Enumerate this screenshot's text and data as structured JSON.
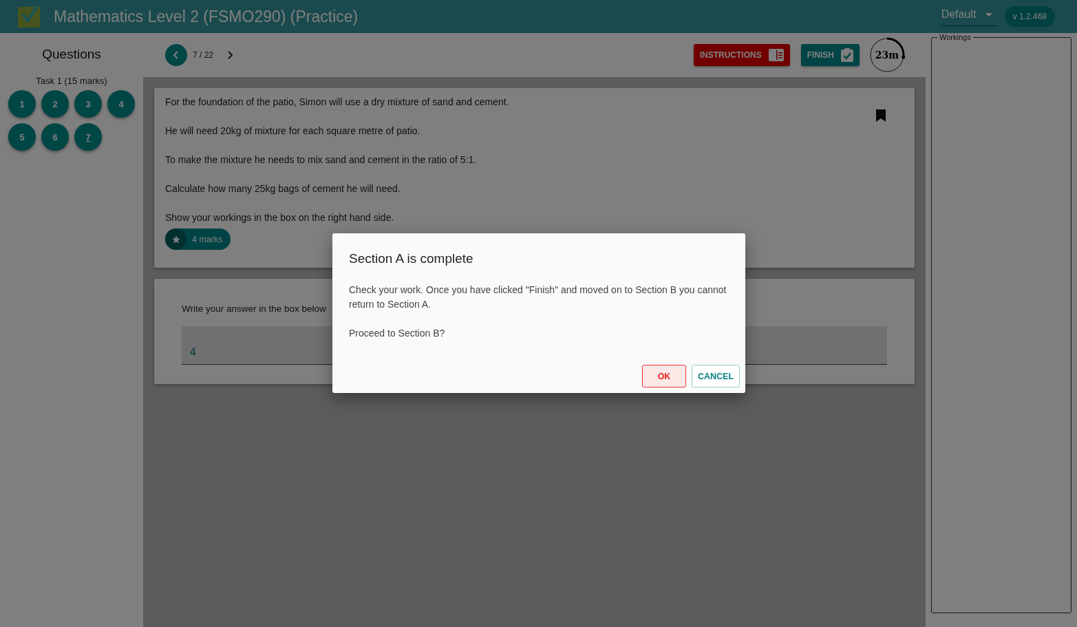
{
  "header": {
    "title": "Mathematics Level 2 (FSMO290) (Practice)",
    "theme_select": {
      "value": "Default"
    },
    "version": "v 1.2.468"
  },
  "sidebar": {
    "title": "Questions",
    "task": "Task 1 (15 marks)",
    "questions": [
      {
        "label": "1",
        "selected": false
      },
      {
        "label": "2",
        "selected": false
      },
      {
        "label": "3",
        "selected": false
      },
      {
        "label": "4",
        "selected": false
      },
      {
        "label": "5",
        "selected": false
      },
      {
        "label": "6",
        "selected": false
      },
      {
        "label": "7",
        "selected": true
      }
    ]
  },
  "toolbar": {
    "position": "7 / 22",
    "instructions": "INSTRUCTIONS",
    "finish": "FINISH",
    "timer": {
      "label": "23m",
      "level": 0.27
    }
  },
  "question": {
    "paragraphs": [
      "For the foundation of the patio, Simon will use a dry mixture of sand and cement.",
      "He will need 20kg of mixture for each square metre of patio.",
      "To make the mixture he needs to mix sand and cement in the ratio of 5:1.",
      "Calculate how many 25kg bags of cement he will need.",
      "Show your workings in the box on the right hand side."
    ],
    "bookmarked": true,
    "marks": "4 marks"
  },
  "answer": {
    "prompt": "Write your answer in the box below",
    "value": "4"
  },
  "workings": {
    "legend": "Workings"
  },
  "dialog": {
    "title": "Section A is complete",
    "message": "Check your work. Once you have clicked \"Finish\" and moved on to Section B you cannot return to Section A.",
    "question": "Proceed to Section B?",
    "ok": "OK",
    "cancel": "CANCEL"
  }
}
